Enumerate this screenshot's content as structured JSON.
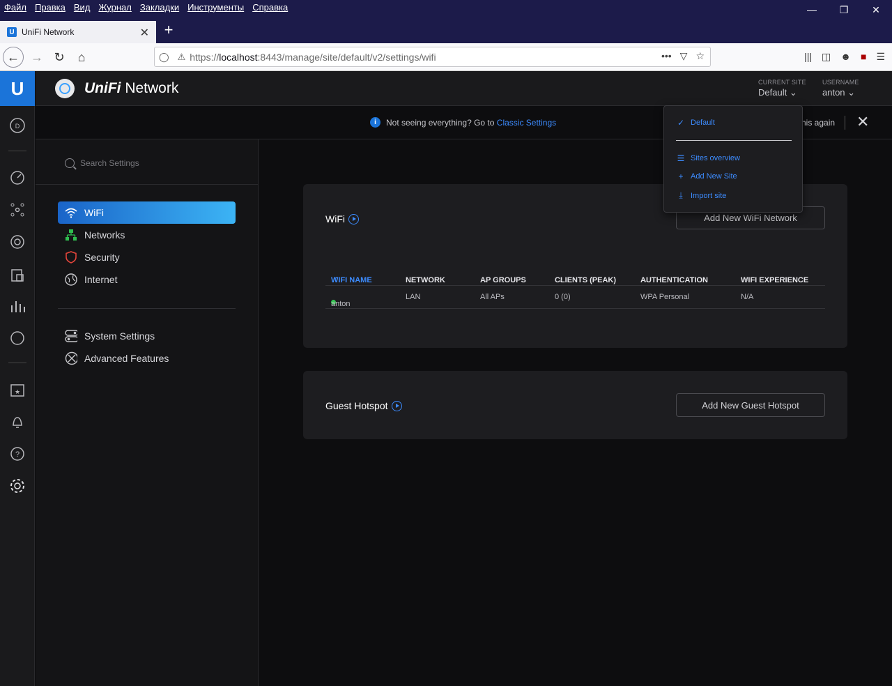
{
  "browser": {
    "menu": [
      "Файл",
      "Правка",
      "Вид",
      "Журнал",
      "Закладки",
      "Инструменты",
      "Справка"
    ],
    "tab_title": "UniFi Network",
    "tab_favicon": "U",
    "url_prefix": "https://",
    "url_host": "localhost",
    "url_rest": ":8443/manage/site/default/v2/settings/wifi"
  },
  "header": {
    "brand_italic": "UniFi",
    "brand_rest": " Network",
    "current_site_label": "CURRENT SITE",
    "current_site_value": "Default",
    "username_label": "USERNAME",
    "username_value": "anton"
  },
  "notice": {
    "text": "Not seeing everything? Go to",
    "link": "Classic Settings",
    "dismiss_text": "his again"
  },
  "sidebar": {
    "search_placeholder": "Search Settings",
    "items": [
      {
        "label": "WiFi",
        "icon": "wifi-icon"
      },
      {
        "label": "Networks",
        "icon": "networks-icon"
      },
      {
        "label": "Security",
        "icon": "shield-icon"
      },
      {
        "label": "Internet",
        "icon": "globe-icon"
      }
    ],
    "items2": [
      {
        "label": "System Settings",
        "icon": "system-settings-icon"
      },
      {
        "label": "Advanced Features",
        "icon": "advanced-features-icon"
      }
    ]
  },
  "wifi_card": {
    "title": "WiFi",
    "add_button": "Add New WiFi Network",
    "columns": [
      "WIFI NAME",
      "NETWORK",
      "AP GROUPS",
      "CLIENTS (PEAK)",
      "AUTHENTICATION",
      "WIFI EXPERIENCE"
    ],
    "rows": [
      {
        "name": "anton",
        "network": "LAN",
        "ap_groups": "All APs",
        "clients": "0 (0)",
        "auth": "WPA Personal",
        "experience": "N/A"
      }
    ]
  },
  "hotspot_card": {
    "title": "Guest Hotspot",
    "add_button": "Add New Guest Hotspot"
  },
  "site_dropdown": {
    "selected": "Default",
    "actions": [
      "Sites overview",
      "Add New Site",
      "Import site"
    ]
  },
  "colors": {
    "accent": "#3d8cff",
    "brand_blue": "#1b74d9",
    "status_green": "#38c754"
  }
}
